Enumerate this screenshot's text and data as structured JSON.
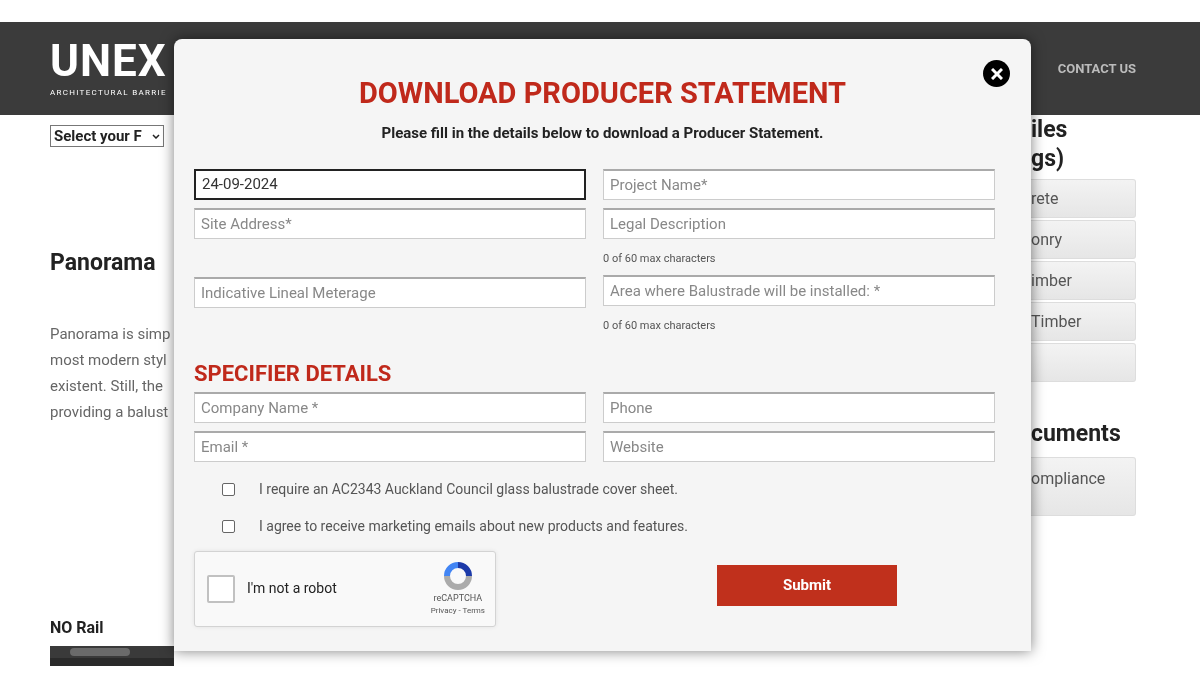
{
  "header": {
    "logo": "UNEX",
    "logo_tagline": "ARCHITECTURAL BARRIE",
    "nav": [
      "CONTACT US"
    ]
  },
  "page": {
    "select": "Select your F",
    "heading": "Panorama",
    "paragraph_lines": [
      "Panorama is simp",
      "most modern styl",
      "existent. Still, the",
      "providing a balust"
    ],
    "subheading": "NO Rail",
    "side_heading_lines": [
      "iles",
      "gs)"
    ],
    "side_buttons": [
      {
        "kind": "labelled",
        "label": "rete"
      },
      {
        "kind": "labelled",
        "label": "onry"
      },
      {
        "kind": "labelled",
        "label": "imber"
      },
      {
        "kind": "labelled",
        "label": "Timber"
      },
      {
        "kind": "blank"
      }
    ],
    "side_heading_2": "cuments",
    "side_buttons_2": [
      "ompliance"
    ]
  },
  "modal": {
    "title": "DOWNLOAD PRODUCER STATEMENT",
    "intro": "Please fill in the details below to download a Producer Statement.",
    "project_fields": [
      {
        "value": "24-09-2024",
        "focused": true
      },
      {
        "placeholder": "Project Name*",
        "focused": false
      },
      {
        "placeholder": "Site Address*",
        "focused": false
      },
      {
        "placeholder": "Legal Description",
        "focused": false,
        "hint": "0 of 60 max characters"
      },
      {
        "placeholder": "Indicative Lineal Meterage",
        "focused": false
      },
      {
        "placeholder": "Area where Balustrade will be installed: *",
        "focused": false,
        "hint": "0 of 60 max characters"
      }
    ],
    "section_heading": "SPECIFIER DETAILS",
    "specifier_fields": [
      {
        "placeholder": "Company Name *",
        "focused": false
      },
      {
        "placeholder": "Phone",
        "focused": false
      },
      {
        "placeholder": "Email *",
        "focused": false
      },
      {
        "placeholder": "Website",
        "focused": false
      }
    ],
    "checkboxes": [
      {
        "label": "I require an AC2343 Auckland Council glass balustrade cover sheet.",
        "checked": false
      },
      {
        "label": "I agree to receive marketing emails about new products and features.",
        "checked": false
      }
    ],
    "captcha": {
      "label": "I'm not a robot",
      "checked": false,
      "brand": "reCAPTCHA",
      "links": "Privacy - Terms"
    },
    "submit": "Submit"
  }
}
